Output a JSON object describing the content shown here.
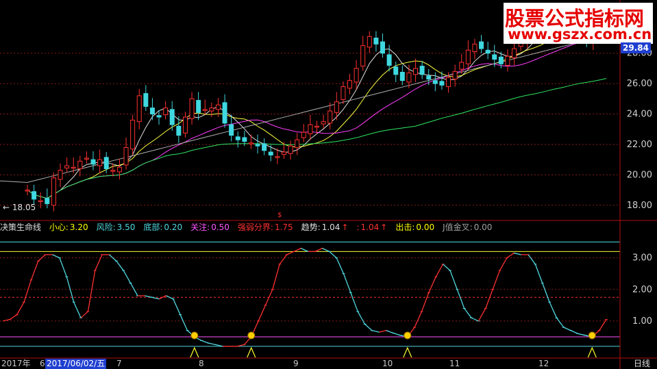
{
  "watermark": {
    "line1": "股票公式指标网",
    "line2": "www.gszx.com.cn"
  },
  "last_price": "29.84",
  "low_label": "← 18.05",
  "indicator": {
    "name": "决策生命线",
    "items": [
      {
        "label": "小心:",
        "value": "3.20",
        "color": "#ffff00"
      },
      {
        "label": "风险:",
        "value": "3.50",
        "color": "#4fd8e0"
      },
      {
        "label": "底部:",
        "value": "0.20",
        "color": "#4fd8e0"
      },
      {
        "label": "关注:",
        "value": "0.50",
        "color": "#ff55ff"
      },
      {
        "label": "强弱分界:",
        "value": "1.75",
        "color": "#ff3030"
      },
      {
        "label": "趋势:",
        "value": "1.04",
        "color": "#e0e0e0",
        "arrow": "↑"
      },
      {
        "label": ":",
        "value": "1.04",
        "color": "#ff3030",
        "arrow": "↑"
      },
      {
        "label": "出击:",
        "value": "0.00",
        "color": "#ffff00"
      },
      {
        "label": "J值金叉:",
        "value": "0.00",
        "color": "#a0a0a0"
      }
    ],
    "dollar_mark": "$"
  },
  "timebar": {
    "year_label": "2017年",
    "prefix": "6",
    "selected_date": "2017/06/02/五",
    "months": [
      "7",
      "8",
      "9",
      "10",
      "11",
      "12"
    ],
    "period": "日线"
  },
  "chart_data": [
    {
      "type": "candlestick",
      "yticks": [
        "18.00",
        "20.00",
        "22.00",
        "24.00",
        "26.00",
        "28.00"
      ],
      "ylim": [
        17.0,
        31.5
      ],
      "close_approx": [
        19.0,
        18.4,
        18.3,
        18.1,
        19.8,
        20.3,
        20.6,
        20.5,
        20.9,
        21.1,
        20.7,
        21.0,
        20.4,
        20.3,
        20.5,
        21.8,
        23.6,
        25.2,
        24.5,
        24.0,
        23.8,
        24.4,
        23.3,
        22.6,
        23.8,
        25.0,
        24.1,
        24.3,
        24.4,
        24.6,
        23.4,
        22.6,
        22.3,
        22.2,
        22.1,
        21.9,
        21.6,
        21.3,
        21.2,
        21.5,
        21.9,
        22.3,
        22.8,
        23.3,
        23.2,
        23.5,
        24.2,
        24.8,
        25.8,
        26.2,
        27.0,
        28.5,
        29.1,
        28.6,
        28.0,
        27.2,
        26.6,
        26.2,
        26.7,
        27.0,
        26.6,
        26.3,
        26.0,
        25.9,
        26.4,
        26.8,
        27.4,
        28.2,
        28.6,
        28.3,
        28.0,
        27.6,
        27.3,
        27.8,
        28.3,
        28.8,
        29.2,
        29.6,
        30.3,
        30.6,
        30.1,
        29.7,
        29.4,
        29.2,
        29.0,
        28.8,
        29.1,
        29.5,
        29.84
      ]
    },
    {
      "type": "line",
      "title": "决策生命线",
      "yticks": [
        "1.00",
        "2.00",
        "3.00"
      ],
      "ylim": [
        -0.15,
        3.75
      ],
      "reference_lines": {
        "小心": 3.2,
        "风险": 3.5,
        "底部": 0.2,
        "关注": 0.5,
        "强弱分界": 1.75
      },
      "values": [
        1.0,
        1.05,
        1.2,
        1.6,
        2.3,
        2.9,
        3.1,
        3.1,
        3.0,
        2.4,
        1.6,
        1.1,
        1.3,
        2.6,
        3.1,
        3.1,
        2.9,
        2.6,
        2.2,
        1.8,
        1.8,
        1.75,
        1.7,
        1.8,
        1.7,
        1.2,
        0.7,
        0.5,
        0.38,
        0.3,
        0.25,
        0.2,
        0.2,
        0.2,
        0.25,
        0.5,
        1.0,
        1.5,
        2.0,
        2.8,
        3.1,
        3.2,
        3.3,
        3.2,
        3.2,
        3.3,
        3.2,
        3.0,
        2.5,
        1.9,
        1.3,
        0.9,
        0.7,
        0.65,
        0.7,
        0.62,
        0.55,
        0.5,
        0.8,
        1.3,
        1.9,
        2.4,
        2.8,
        2.6,
        2.0,
        1.4,
        1.1,
        1.0,
        1.4,
        2.0,
        2.6,
        3.0,
        3.15,
        3.1,
        3.1,
        2.8,
        2.2,
        1.6,
        1.1,
        0.8,
        0.7,
        0.6,
        0.55,
        0.5,
        0.7,
        1.05
      ],
      "buy_signals": [
        27,
        35,
        57,
        83
      ],
      "dots": [
        27,
        35,
        57,
        83
      ]
    }
  ]
}
